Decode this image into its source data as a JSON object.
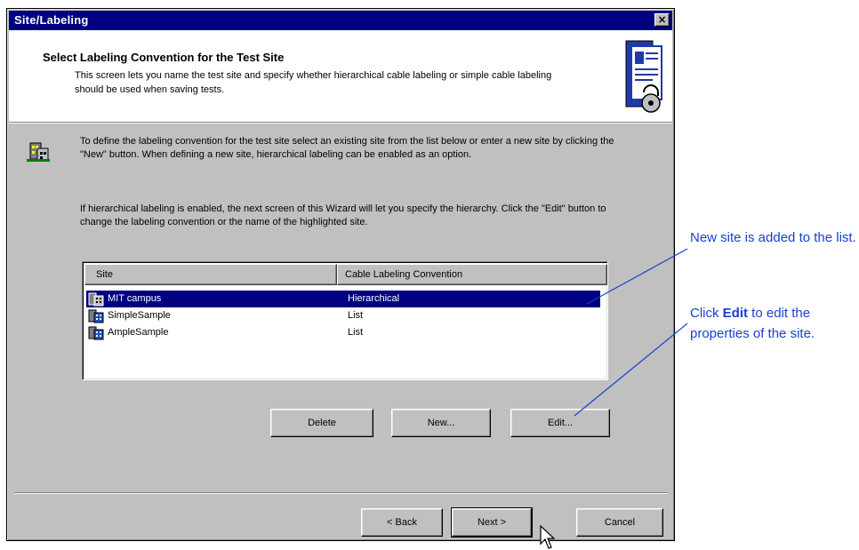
{
  "window": {
    "title": "Site/Labeling",
    "close_glyph": "×"
  },
  "header": {
    "title": "Select Labeling Convention for the Test Site",
    "description": "This screen lets you name the test site and specify whether hierarchical cable labeling or simple cable labeling should be used when saving tests.",
    "graphic_icon": "wizard-document-lock-icon"
  },
  "body": {
    "icon": "site-building-icon",
    "paragraph1": "To define the labeling convention for the test site select an existing site from the list below or enter a new site by clicking the \"New\" button. When defining a new site, hierarchical labeling can be enabled as an option.",
    "paragraph2": "If hierarchical labeling is enabled, the next screen of this Wizard will let you specify the hierarchy. Click the \"Edit\" button to change the labeling convention or the name of the highlighted site."
  },
  "site_list": {
    "columns": [
      "Site",
      "Cable Labeling Convention"
    ],
    "rows": [
      {
        "site": "MIT campus",
        "convention": "Hierarchical",
        "selected": true,
        "icon": "site-icon"
      },
      {
        "site": "SimpleSample",
        "convention": "List",
        "selected": false,
        "icon": "site-icon"
      },
      {
        "site": "AmpleSample",
        "convention": "List",
        "selected": false,
        "icon": "site-icon"
      }
    ]
  },
  "buttons": {
    "delete": "Delete",
    "new": "New...",
    "edit": "Edit...",
    "back": "< Back",
    "next": "Next >",
    "cancel": "Cancel"
  },
  "callouts": {
    "added": "New site is added to the list.",
    "edit_prefix": "Click ",
    "edit_bold": "Edit",
    "edit_suffix": " to edit the properties of the site."
  },
  "colors": {
    "titlebar": "#000080",
    "selection": "#000080",
    "callout_text": "#1a3fd0",
    "dialog_face": "#c0c0c0"
  }
}
